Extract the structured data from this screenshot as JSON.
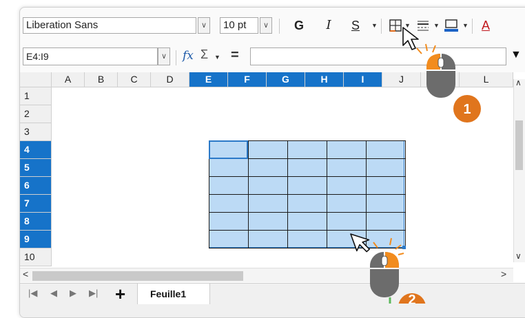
{
  "toolbar": {
    "font_name": "Liberation Sans",
    "font_size": "10 pt",
    "bold_label": "G",
    "italic_label": "I",
    "underline_label": "S",
    "font_color_label": "A"
  },
  "formula_bar": {
    "name_box": "E4:I9",
    "fx_label": "fx",
    "sigma_label": "Σ",
    "equals_label": "=",
    "formula_value": ""
  },
  "columns": [
    {
      "label": "A",
      "selected": false
    },
    {
      "label": "B",
      "selected": false
    },
    {
      "label": "C",
      "selected": false
    },
    {
      "label": "D",
      "selected": false
    },
    {
      "label": "E",
      "selected": true
    },
    {
      "label": "F",
      "selected": true
    },
    {
      "label": "G",
      "selected": true
    },
    {
      "label": "H",
      "selected": true
    },
    {
      "label": "I",
      "selected": true
    },
    {
      "label": "J",
      "selected": false
    },
    {
      "label": "K",
      "selected": false
    },
    {
      "label": "L",
      "selected": false
    }
  ],
  "rows": [
    {
      "label": "1",
      "selected": false
    },
    {
      "label": "2",
      "selected": false
    },
    {
      "label": "3",
      "selected": false
    },
    {
      "label": "4",
      "selected": true
    },
    {
      "label": "5",
      "selected": true
    },
    {
      "label": "6",
      "selected": true
    },
    {
      "label": "7",
      "selected": true
    },
    {
      "label": "8",
      "selected": true
    },
    {
      "label": "9",
      "selected": true
    },
    {
      "label": "10",
      "selected": false
    }
  ],
  "sheet_tabs": {
    "add_label": "+",
    "active_tab": "Feuille1"
  },
  "steps": {
    "step1": "1",
    "step2": "2"
  },
  "colors": {
    "selection_header": "#1673c9",
    "selection_fill": "#bcdaf5",
    "badge": "#e0751d",
    "mouse_button_highlight": "#f28c1e"
  }
}
